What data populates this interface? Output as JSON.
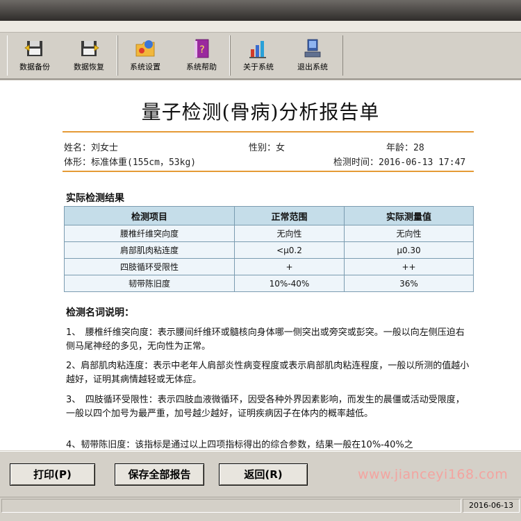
{
  "toolbar": {
    "items": [
      {
        "label": "数据备份",
        "icon": "floppy-disk-backup-icon"
      },
      {
        "label": "数据恢复",
        "icon": "floppy-disk-restore-icon"
      },
      {
        "label": "系统设置",
        "icon": "folder-settings-icon"
      },
      {
        "label": "系统帮助",
        "icon": "help-book-icon"
      },
      {
        "label": "关于系统",
        "icon": "bar-chart-about-icon"
      },
      {
        "label": "退出系统",
        "icon": "computer-exit-icon"
      }
    ]
  },
  "report": {
    "title": "量子检测(骨病)分析报告单",
    "name": "姓名：刘女士",
    "gender": "性别：女",
    "age": "年龄：28",
    "body": "体形：标准体重(155cm，53kg)",
    "time": "检测时间：2016-06-13 17:47",
    "results_heading": "实际检测结果",
    "table": {
      "headers": [
        "检测项目",
        "正常范围",
        "实际测量值"
      ],
      "rows": [
        [
          "腰椎纤维突向度",
          "无向性",
          "无向性"
        ],
        [
          "肩部肌肉粘连度",
          "<μ0.2",
          "μ0.30"
        ],
        [
          "四肢循环受限性",
          "+",
          "++"
        ],
        [
          "韧带陈旧度",
          "10%-40%",
          "36%"
        ]
      ]
    },
    "explain_heading": "检测名词说明：",
    "paragraphs": [
      "1、　腰椎纤维突向度：表示腰间纤维环或髓核向身体哪一侧突出或旁突或彭突。一般以向左侧压迫右侧马尾神经的多见，无向性为正常。",
      "2、肩部肌肉粘连度：表示中老年人肩部炎性病变程度或表示肩部肌肉粘连程度，一般以所测的值越小越好，证明其病情越轻或无体症。",
      "3、　四肢循环受限性：表示四肢血液微循环，因受各种外界因素影响，而发生的晨僵或活动受限度，一般以四个加号为最严重，加号越少越好，证明疾病因子在体内的概率越低。",
      "4、韧带陈旧度：该指标是通过以上四项指标得出的综合参数，结果一般在10%-40%之"
    ]
  },
  "buttons": {
    "print": "打印(P)",
    "save_all": "保存全部报告",
    "back": "返回(R)"
  },
  "watermark": "www.jianceyi168.com",
  "status": {
    "left": "",
    "date": "2016-06-13"
  },
  "colors": {
    "accent_line": "#e59a35",
    "table_header": "#c5dde9",
    "table_cell": "#eef5fa"
  }
}
